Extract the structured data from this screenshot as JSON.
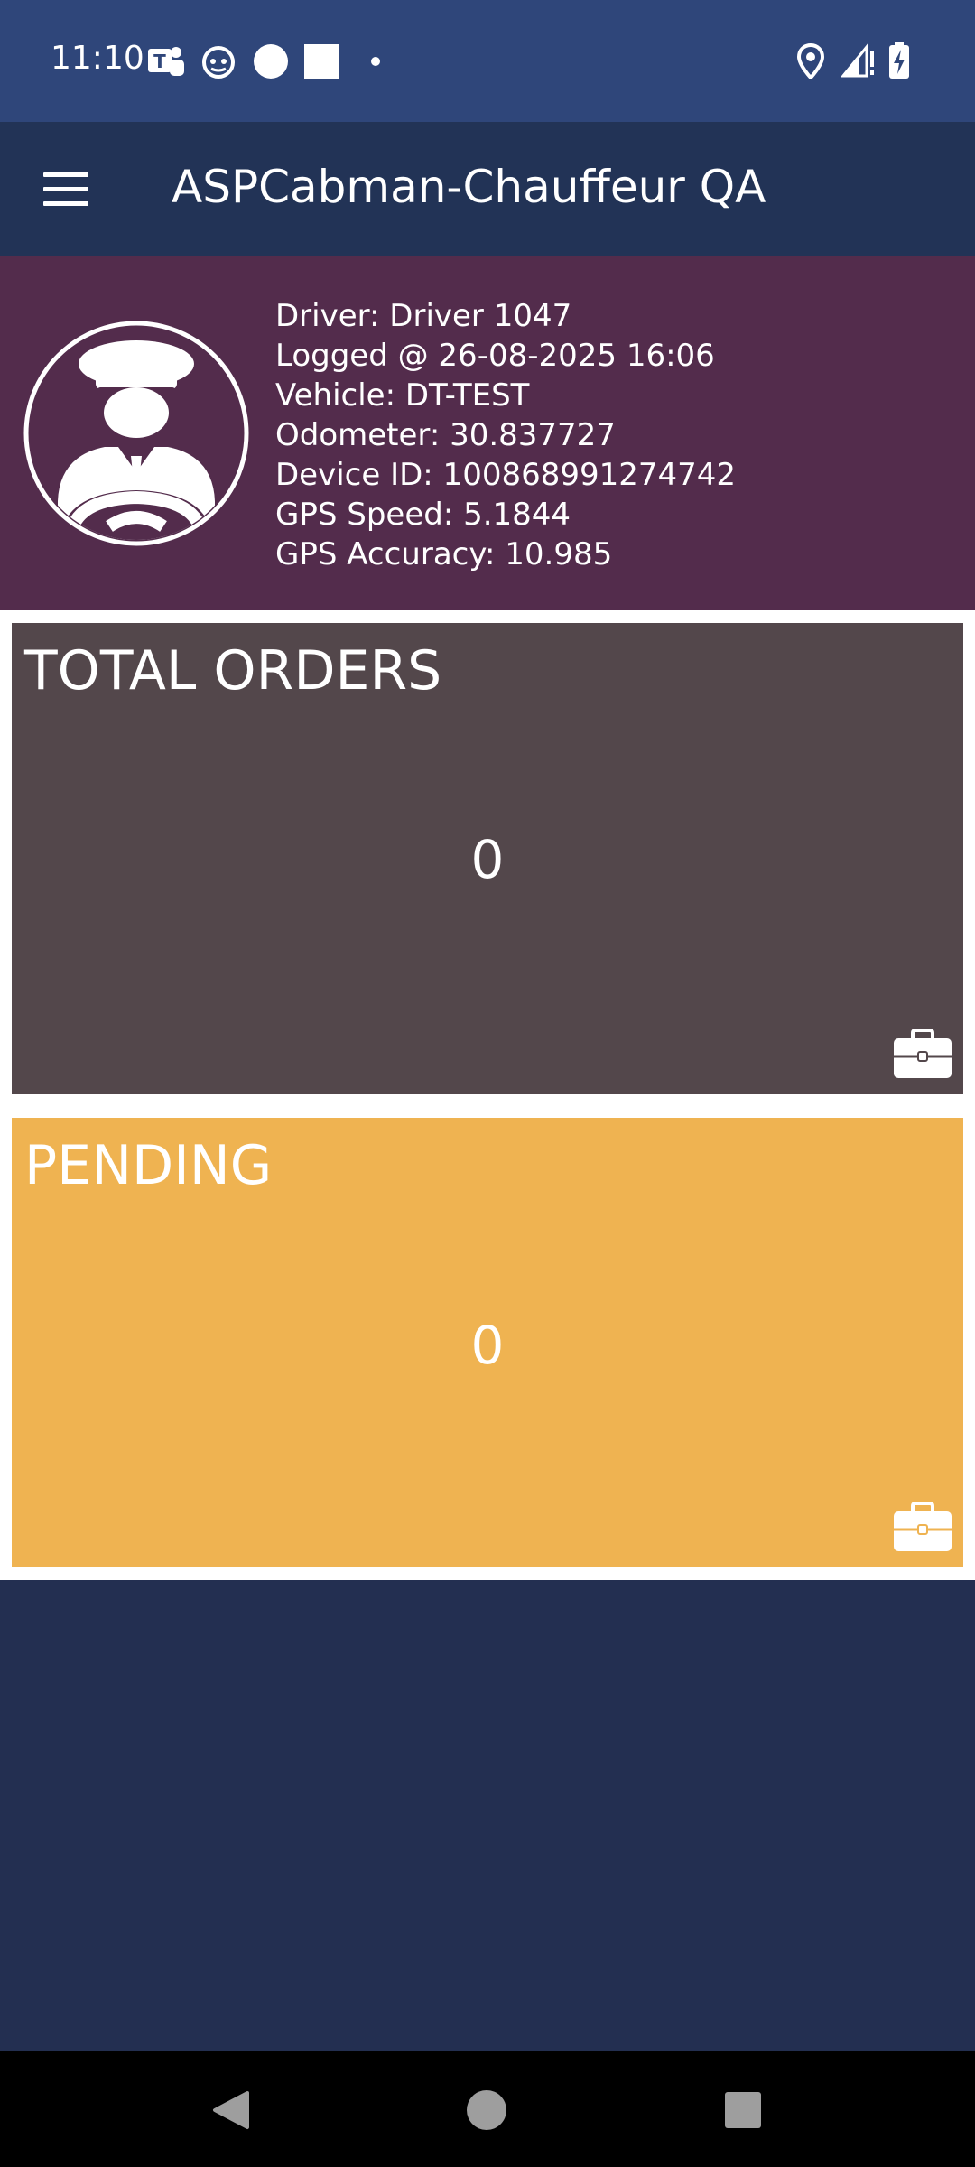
{
  "status_bar": {
    "time": "11:10",
    "icons_left": [
      "teams-icon",
      "cat-face-icon",
      "circle-icon",
      "square-icon",
      "dot-icon"
    ],
    "icons_right": [
      "location-icon",
      "signal-icon",
      "battery-charging-icon"
    ]
  },
  "app_bar": {
    "title": "ASPCabman-Chauffeur QA",
    "menu_icon": "hamburger-menu-icon"
  },
  "profile": {
    "avatar_icon": "chauffeur-avatar-icon",
    "driver": "Driver: Driver 1047",
    "logged": "Logged @ 26-08-2025 16:06",
    "vehicle": "Vehicle: DT-TEST",
    "odometer": "Odometer: 30.837727",
    "device_id": "Device ID: 100868991274742",
    "gps_speed": "GPS Speed: 5.1844",
    "gps_accuracy": "GPS Accuracy: 10.985"
  },
  "cards": {
    "total": {
      "title": "TOTAL ORDERS",
      "value": "0",
      "icon": "briefcase-icon",
      "color": "#53474b"
    },
    "pending": {
      "title": "PENDING",
      "value": "0",
      "icon": "briefcase-icon",
      "color": "#efb351"
    }
  },
  "colors": {
    "status_bar": "#2f467a",
    "app_bar": "#223356",
    "profile_bg": "#532c4c",
    "page_bg": "#232f51"
  },
  "nav_bar": {
    "back_icon": "back-triangle-icon",
    "home_icon": "home-circle-icon",
    "recents_icon": "recents-square-icon"
  }
}
